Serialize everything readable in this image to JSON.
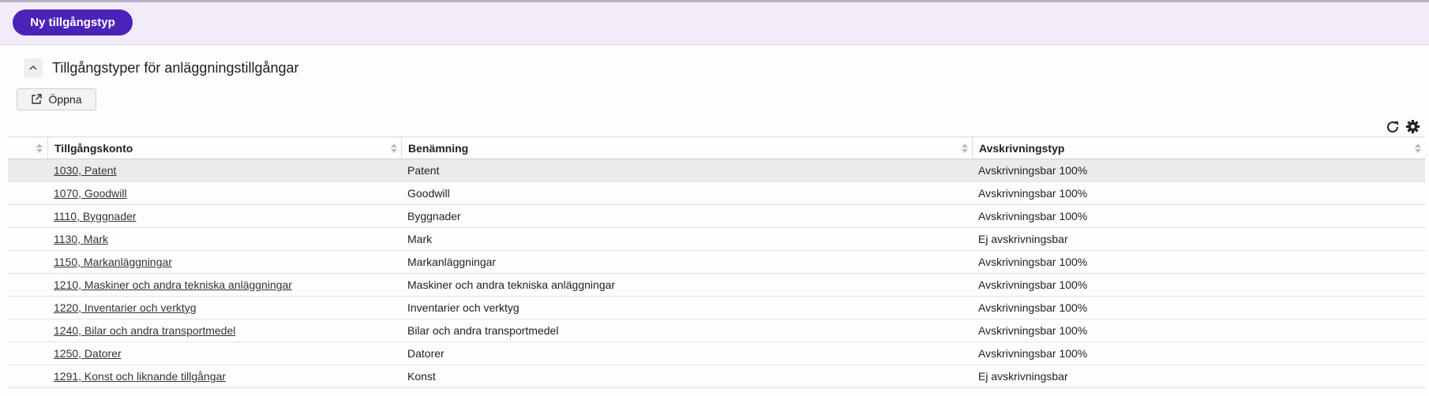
{
  "toolbar": {
    "new_button_label": "Ny tillgångstyp"
  },
  "section": {
    "title": "Tillgångstyper för anläggningstillgångar"
  },
  "actions": {
    "open_label": "Öppna"
  },
  "icons": {
    "collapse": "chevron-up-icon",
    "open": "external-link-icon",
    "refresh": "refresh-icon",
    "settings": "gear-icon",
    "sort": "sort-icon"
  },
  "colors": {
    "primary": "#4b23b8",
    "topbar": "#f2ecf8",
    "selected_row": "#ebebeb"
  },
  "table": {
    "columns": [
      "Tillgångskonto",
      "Benämning",
      "Avskrivningstyp"
    ],
    "rows": [
      {
        "account": "1030, Patent",
        "name": "Patent",
        "type": "Avskrivningsbar 100%"
      },
      {
        "account": "1070, Goodwill",
        "name": "Goodwill",
        "type": "Avskrivningsbar 100%"
      },
      {
        "account": "1110, Byggnader",
        "name": "Byggnader",
        "type": "Avskrivningsbar 100%"
      },
      {
        "account": "1130, Mark",
        "name": "Mark",
        "type": "Ej avskrivningsbar"
      },
      {
        "account": "1150, Markanläggningar",
        "name": "Markanläggningar",
        "type": "Avskrivningsbar 100%"
      },
      {
        "account": "1210, Maskiner och andra tekniska anläggningar",
        "name": "Maskiner och andra tekniska anläggningar",
        "type": "Avskrivningsbar 100%"
      },
      {
        "account": "1220, Inventarier och verktyg",
        "name": "Inventarier och verktyg",
        "type": "Avskrivningsbar 100%"
      },
      {
        "account": "1240, Bilar och andra transportmedel",
        "name": "Bilar och andra transportmedel",
        "type": "Avskrivningsbar 100%"
      },
      {
        "account": "1250, Datorer",
        "name": "Datorer",
        "type": "Avskrivningsbar 100%"
      },
      {
        "account": "1291, Konst och liknande tillgångar",
        "name": "Konst",
        "type": "Ej avskrivningsbar"
      }
    ]
  }
}
